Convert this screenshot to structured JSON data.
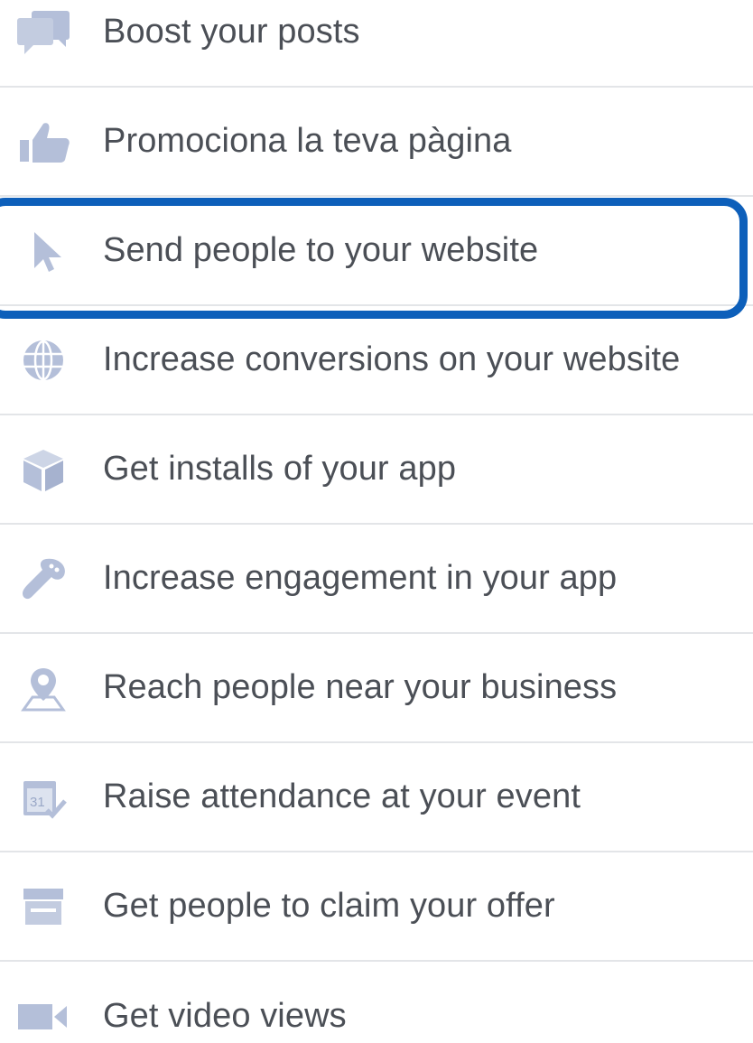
{
  "objectives": {
    "items": [
      {
        "icon": "boost-posts-icon",
        "label": "Boost your posts"
      },
      {
        "icon": "thumbs-up-icon",
        "label": "Promociona la teva pàgina"
      },
      {
        "icon": "cursor-icon",
        "label": "Send people to your website"
      },
      {
        "icon": "globe-icon",
        "label": "Increase conversions on your website"
      },
      {
        "icon": "app-box-icon",
        "label": "Get installs of your app"
      },
      {
        "icon": "game-controller-icon",
        "label": "Increase engagement in your app"
      },
      {
        "icon": "location-person-icon",
        "label": "Reach people near your business"
      },
      {
        "icon": "calendar-icon",
        "label": "Raise attendance at your event"
      },
      {
        "icon": "store-icon",
        "label": "Get people to claim your offer"
      },
      {
        "icon": "video-camera-icon",
        "label": "Get video views"
      }
    ],
    "selected_index": 2
  },
  "colors": {
    "icon": "#b4bfd9",
    "text": "#4b4f56",
    "divider": "#e3e5e8",
    "highlight": "#0d5fba"
  }
}
